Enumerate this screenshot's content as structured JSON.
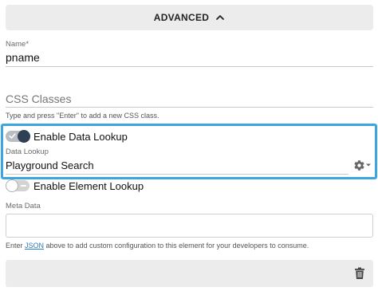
{
  "advanced": {
    "label": "ADVANCED",
    "icon": "chevron-up-icon"
  },
  "name_field": {
    "label": "Name*",
    "value": "pname"
  },
  "css_classes": {
    "placeholder": "CSS Classes",
    "hint": "Type and press \"Enter\" to add a new CSS class."
  },
  "data_lookup": {
    "toggle_label": "Enable Data Lookup",
    "enabled": true,
    "field_label": "Data Lookup",
    "value": "Playground Search",
    "settings_icon": "gear-icon"
  },
  "element_lookup": {
    "toggle_label": "Enable Element Lookup",
    "enabled": false
  },
  "meta_data": {
    "label": "Meta Data",
    "value": "",
    "hint_prefix": "Enter ",
    "hint_link": "JSON",
    "hint_suffix": " above to add custom configuration to this element for your developers to consume."
  },
  "footer": {
    "delete_icon": "trash-icon"
  },
  "colors": {
    "highlight_border": "#3ba5e0",
    "toggle_on_knob": "#2f4055",
    "link": "#2b7bbf"
  }
}
